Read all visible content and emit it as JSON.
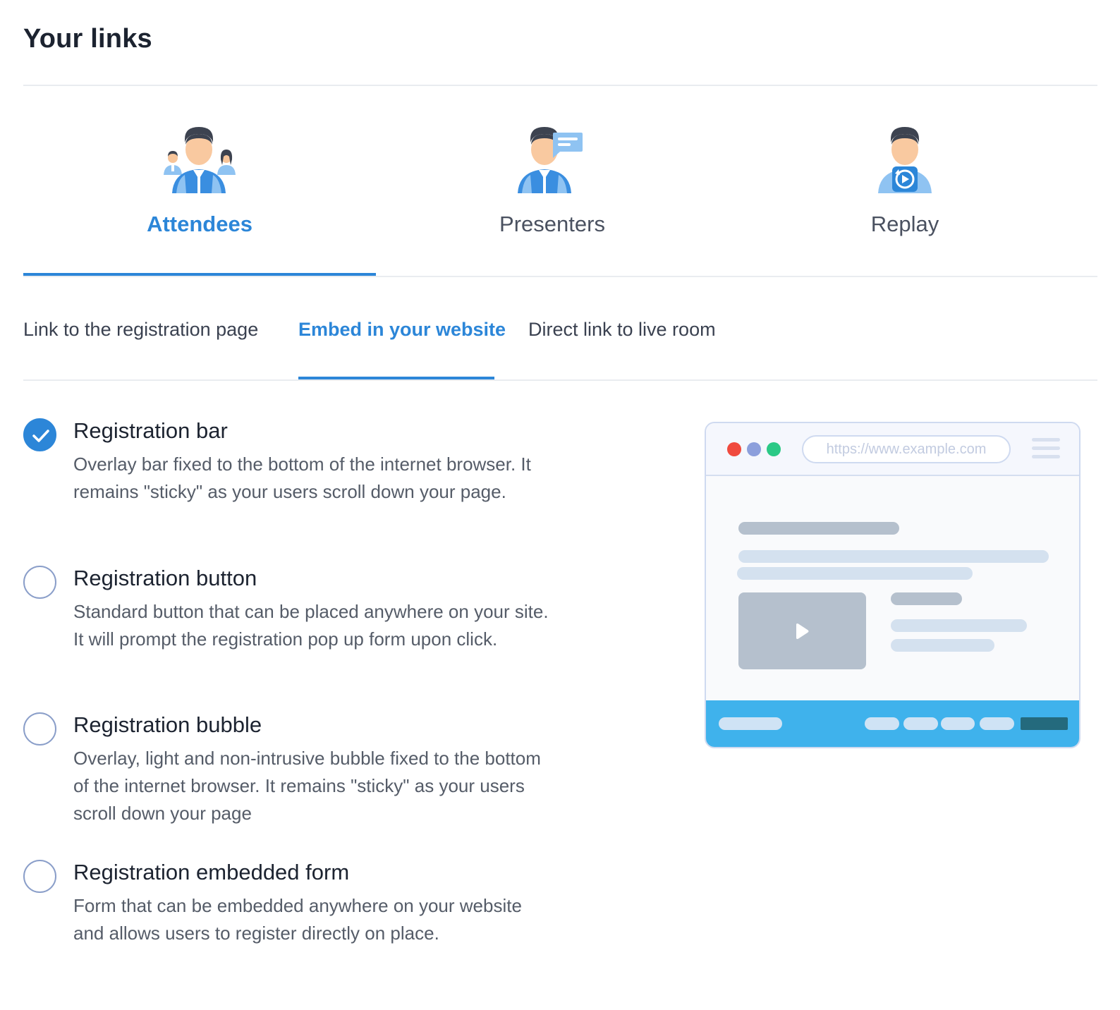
{
  "page": {
    "title": "Your links"
  },
  "role_tabs": [
    {
      "label": "Attendees",
      "icon": "attendees-icon",
      "active": true
    },
    {
      "label": "Presenters",
      "icon": "presenters-icon",
      "active": false
    },
    {
      "label": "Replay",
      "icon": "replay-icon",
      "active": false
    }
  ],
  "sub_tabs": [
    {
      "label": "Link to the registration page",
      "active": false
    },
    {
      "label": "Embed in your website",
      "active": true
    },
    {
      "label": "Direct link to live room",
      "active": false
    }
  ],
  "options": [
    {
      "title": "Registration bar",
      "description": "Overlay bar fixed to the bottom of the internet browser. It remains \"sticky\" as your users scroll down your page.",
      "checked": true
    },
    {
      "title": "Registration button",
      "description": "Standard button that can be placed anywhere on your site. It will prompt the registration pop up form upon click.",
      "checked": false
    },
    {
      "title": "Registration bubble",
      "description": "Overlay, light and non-intrusive bubble fixed to the bottom of the internet browser. It remains \"sticky\" as your users scroll down your page",
      "checked": false
    },
    {
      "title": "Registration embedded form",
      "description": "Form that can be embedded anywhere on your website and allows users to register directly on place.",
      "checked": false
    }
  ],
  "preview": {
    "url": "https://www.example.com",
    "colors": {
      "accent": "#2c86d8",
      "bar": "#3fb2ec",
      "cta": "#246a7d",
      "dot_red": "#f04a3e",
      "dot_blue": "#8c9fdc",
      "dot_green": "#2bc986"
    }
  }
}
